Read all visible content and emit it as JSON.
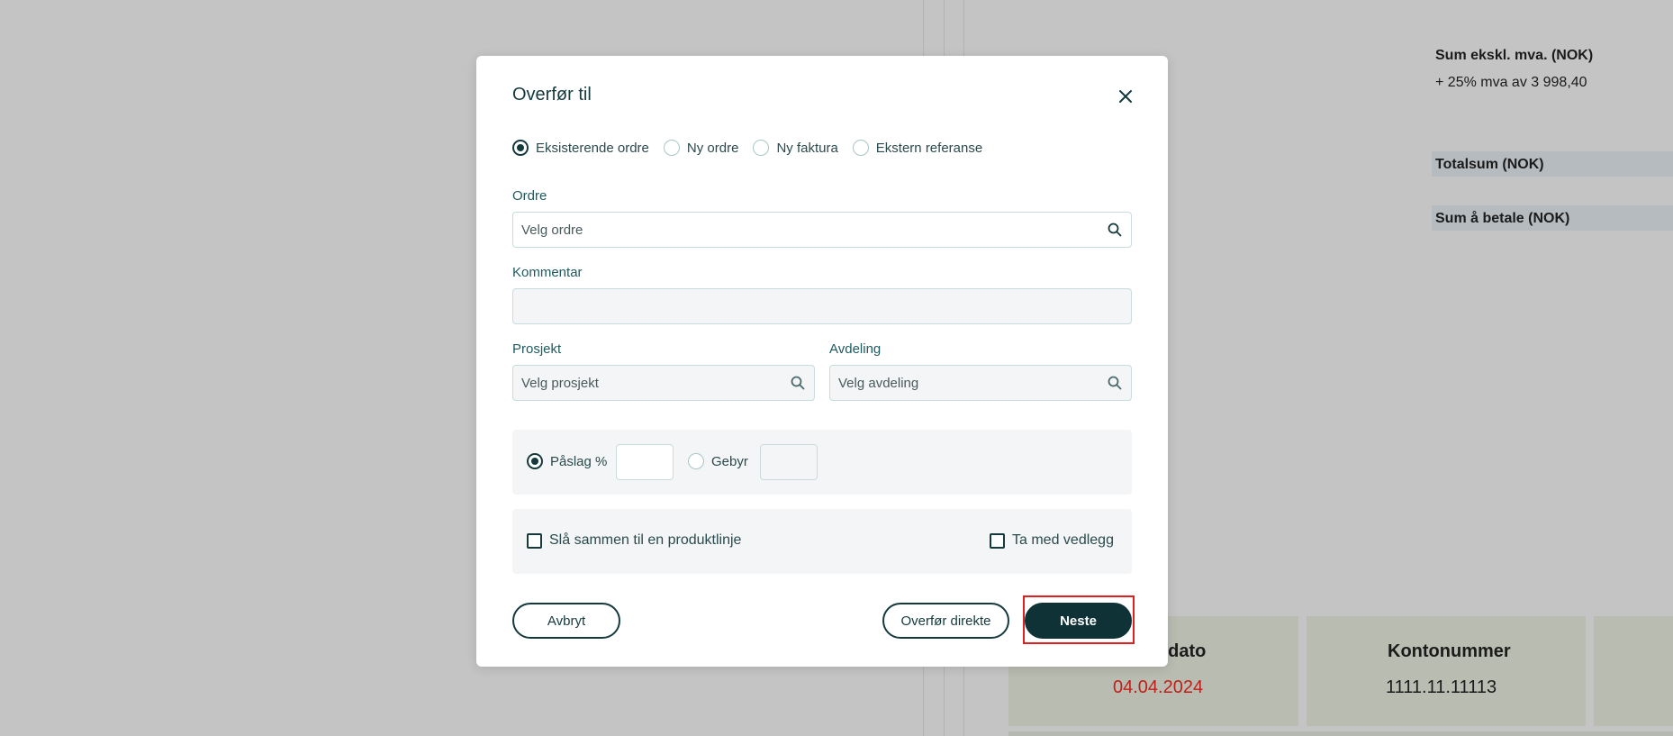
{
  "background": {
    "summary": {
      "sum_excl_vat": "Sum ekskl. mva. (NOK)",
      "vat_line": "+ 25% mva av 3 998,40",
      "total": "Totalsum (NOK)",
      "to_pay": "Sum å betale (NOK)"
    },
    "info": {
      "date_label_partial": "sdato",
      "date_value": "04.04.2024",
      "account_label": "Kontonummer",
      "account_value": "1111.11.11113"
    },
    "colors": {
      "date_value": "#c0201a"
    }
  },
  "modal": {
    "title": "Overfør til",
    "close_icon": "close-icon",
    "radios": [
      {
        "label": "Eksisterende ordre",
        "checked": true
      },
      {
        "label": "Ny ordre",
        "checked": false
      },
      {
        "label": "Ny faktura",
        "checked": false
      },
      {
        "label": "Ekstern referanse",
        "checked": false
      }
    ],
    "order": {
      "label": "Ordre",
      "placeholder": "Velg ordre"
    },
    "comment": {
      "label": "Kommentar",
      "value": ""
    },
    "project": {
      "label": "Prosjekt",
      "placeholder": "Velg prosjekt"
    },
    "department": {
      "label": "Avdeling",
      "placeholder": "Velg avdeling"
    },
    "markup": {
      "percent_label": "Påslag %",
      "percent_checked": true,
      "percent_value": "",
      "fee_label": "Gebyr",
      "fee_checked": false,
      "fee_value": ""
    },
    "options": {
      "merge_label": "Slå sammen til en produktlinje",
      "merge_checked": false,
      "attach_label": "Ta med vedlegg",
      "attach_checked": false
    },
    "buttons": {
      "cancel": "Avbryt",
      "transfer_direct": "Overfør direkte",
      "next": "Neste"
    },
    "colors": {
      "accent": "#153a3e",
      "primary_button": "#0f3236",
      "highlight": "#e02020"
    }
  }
}
